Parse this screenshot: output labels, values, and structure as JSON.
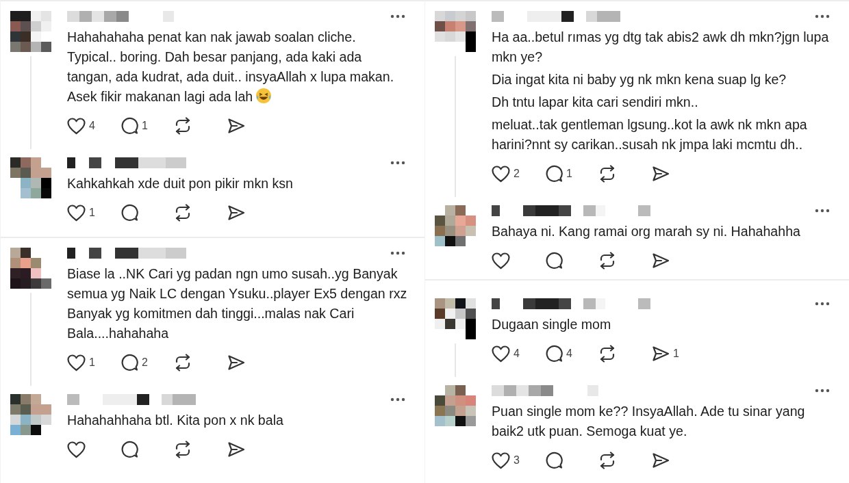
{
  "columns": [
    {
      "threads": [
        {
          "comments": [
            {
              "paragraphs": [
                "Hahahahaha penat kan nak jawab soalan cliche. Typical.. boring. Dah besar panjang, ada kaki ada tangan, ada kudrat, ada duit.. insyaAllah x lupa makan. Asek fikir makanan lagi ada lah"
              ],
              "emoji_after": true,
              "likes": "4",
              "replies": "1"
            },
            {
              "paragraphs": [
                "Kahkahkah xde duit pon pikir mkn ksn"
              ],
              "likes": "1"
            }
          ]
        },
        {
          "comments": [
            {
              "paragraphs": [
                "Biase la ..NK Cari yg padan ngn umo susah..yg Banyak semua yg Naik LC dengan Ysuku..player Ex5 dengan rxz Banyak yg komitmen dah tinggi...malas nak Cari Bala....hahahaha"
              ],
              "likes": "1",
              "replies": "2"
            },
            {
              "paragraphs": [
                "Hahahahhaha btl. Kita pon x nk bala"
              ]
            }
          ]
        }
      ]
    },
    {
      "threads": [
        {
          "comments": [
            {
              "paragraphs": [
                "Ha aa..betul rımas yg dtg tak abis2 awk dh mkn?jgn lupa mkn ye?",
                "Dia ingat kita ni baby yg nk mkn kena suap lg ke?",
                "Dh tntu lapar kita cari sendiri mkn..",
                "meluat..tak gentleman lgsung..kot la awk nk mkn apa harini?nnt sy carikan..susah nk jmpa laki mcmtu dh.."
              ],
              "likes": "2",
              "replies": "1"
            },
            {
              "paragraphs": [
                "Bahaya ni. Kang ramai org marah sy ni. Hahahahha"
              ]
            }
          ]
        },
        {
          "comments": [
            {
              "paragraphs": [
                "Dugaan single mom"
              ],
              "likes": "4",
              "replies": "4",
              "shares": "1"
            },
            {
              "paragraphs": [
                "Puan single mom ke?? InsyaAllah. Ade tu sinar yang baik2 utk puan. Semoga kuat ye."
              ],
              "likes": "3"
            }
          ]
        }
      ]
    }
  ]
}
